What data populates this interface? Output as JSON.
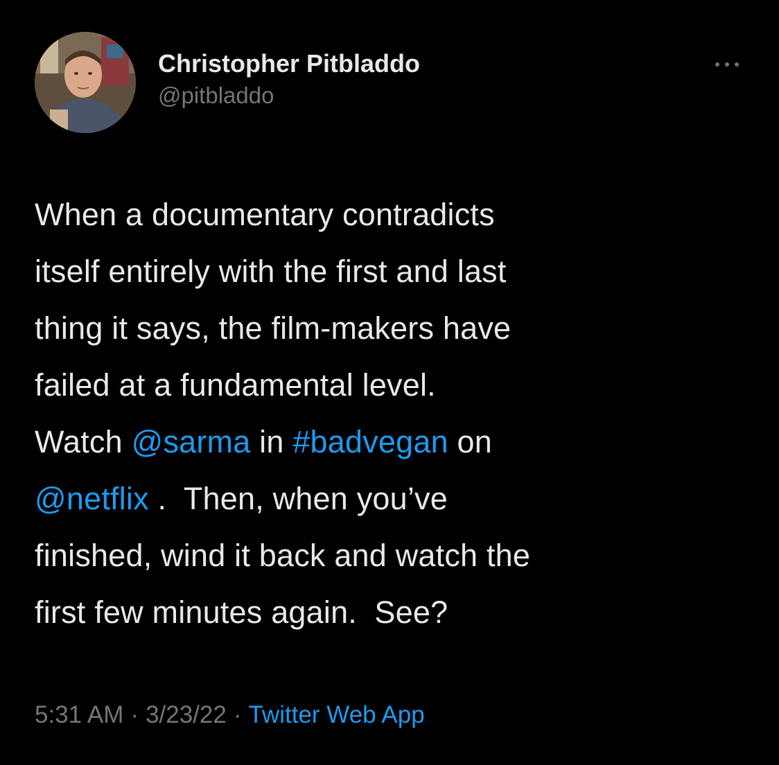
{
  "tweet": {
    "author": {
      "display_name": "Christopher Pitbladdo",
      "handle": "@pitbladdo",
      "avatar_icon": "profile-photo"
    },
    "more_icon": "more-options-icon",
    "body": {
      "line1": "When a documentary contradicts",
      "line2": "itself entirely with the first and last",
      "line3": "thing it says, the film-makers have",
      "line4": "failed at a fundamental level.",
      "line5_a": "Watch ",
      "mention_sarma": "@sarma",
      "line5_b": " in ",
      "hashtag_badvegan": "#badvegan",
      "line5_c": " on",
      "mention_netflix": "@netflix",
      "line6_b": " .  Then, when you’ve",
      "line7": "finished, wind it back and watch the",
      "line8": "first few minutes again.  See?"
    },
    "meta": {
      "time": "5:31 AM",
      "separator": "·",
      "date": "3/23/22",
      "source": "Twitter Web App"
    },
    "colors": {
      "background": "#000000",
      "text": "#e7e9ea",
      "secondary": "#71767b",
      "link": "#1d9bf0"
    }
  }
}
